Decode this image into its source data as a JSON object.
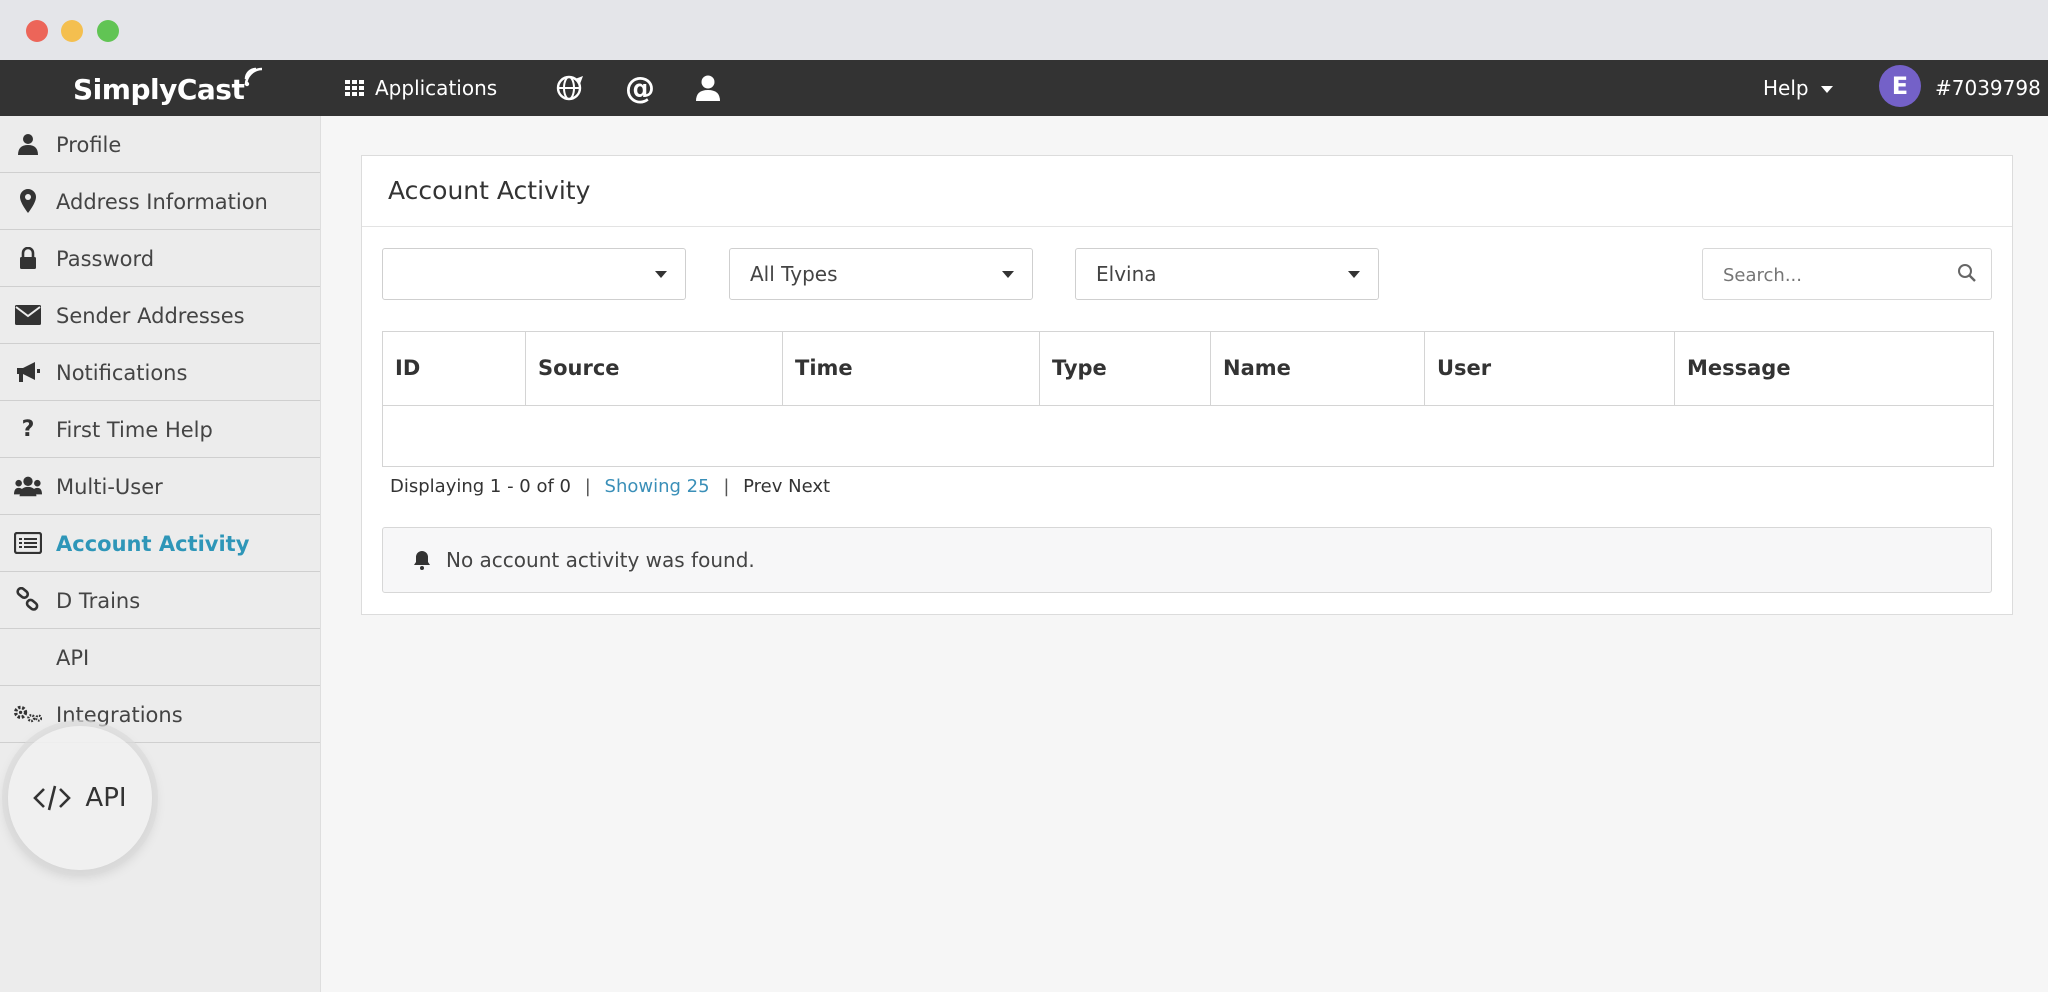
{
  "brand": {
    "logo_text": "SimplyCast"
  },
  "navbar": {
    "applications_label": "Applications",
    "help_label": "Help",
    "avatar_initial": "E",
    "account_id": "#7039798"
  },
  "sidebar": {
    "items": [
      {
        "label": "Profile",
        "icon": "user-icon"
      },
      {
        "label": "Address Information",
        "icon": "map-marker-icon"
      },
      {
        "label": "Password",
        "icon": "lock-icon"
      },
      {
        "label": "Sender Addresses",
        "icon": "envelope-icon"
      },
      {
        "label": "Notifications",
        "icon": "megaphone-icon"
      },
      {
        "label": "First Time Help",
        "icon": "question-icon"
      },
      {
        "label": "Multi-User",
        "icon": "users-icon"
      },
      {
        "label": "Account Activity",
        "icon": "list-icon",
        "active": true
      },
      {
        "label": "D Trains",
        "icon": "link-icon"
      },
      {
        "label": "API",
        "icon": "code-icon"
      },
      {
        "label": "Integrations",
        "icon": "gears-icon"
      }
    ],
    "highlight_label": "API"
  },
  "panel": {
    "title": "Account Activity",
    "filters": [
      {
        "value": ""
      },
      {
        "value": "All Types"
      },
      {
        "value": "Elvina"
      }
    ],
    "search_placeholder": "Search...",
    "columns": [
      "ID",
      "Source",
      "Time",
      "Type",
      "Name",
      "User",
      "Message"
    ],
    "pager": {
      "displaying": "Displaying 1 - 0 of 0",
      "showing": "Showing 25",
      "prev": "Prev",
      "next": "Next"
    },
    "empty_message": "No account activity was found."
  },
  "colors": {
    "accent": "#2e96b8",
    "navbar": "#333333",
    "avatar": "#7461c8"
  }
}
